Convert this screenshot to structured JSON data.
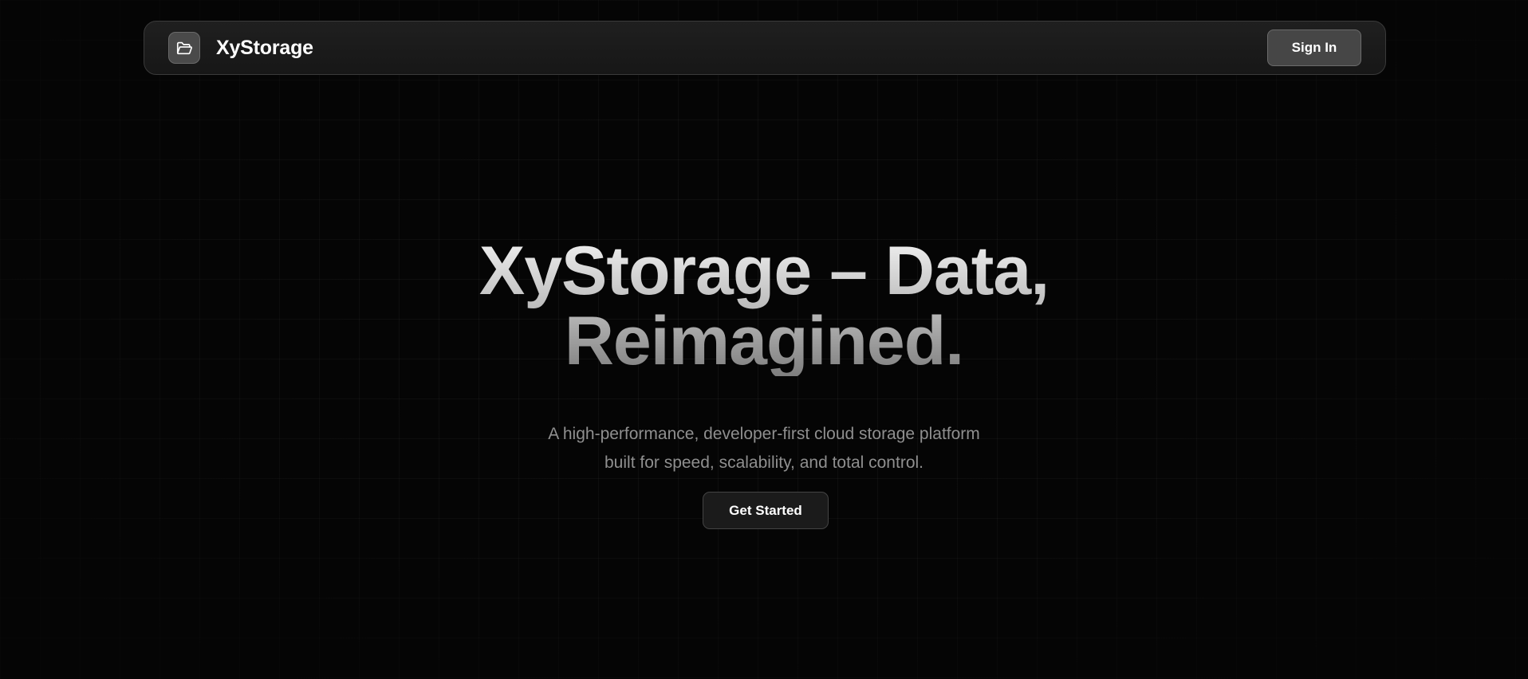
{
  "navbar": {
    "logo_icon": "folder-open-icon",
    "brand_name": "XyStorage",
    "sign_in_label": "Sign In"
  },
  "hero": {
    "title_line_1": "XyStorage – Data,",
    "title_line_2": "Reimagined.",
    "subtitle_line_1": "A high-performance, developer-first cloud storage platform",
    "subtitle_line_2": "built for speed, scalability, and total control.",
    "cta_label": "Get Started"
  },
  "colors": {
    "background": "#050505",
    "navbar_bg": "#1c1c1c",
    "sign_in_bg": "#464646",
    "cta_bg": "#1b1b1b",
    "subtitle_text": "#8f8f8f"
  }
}
